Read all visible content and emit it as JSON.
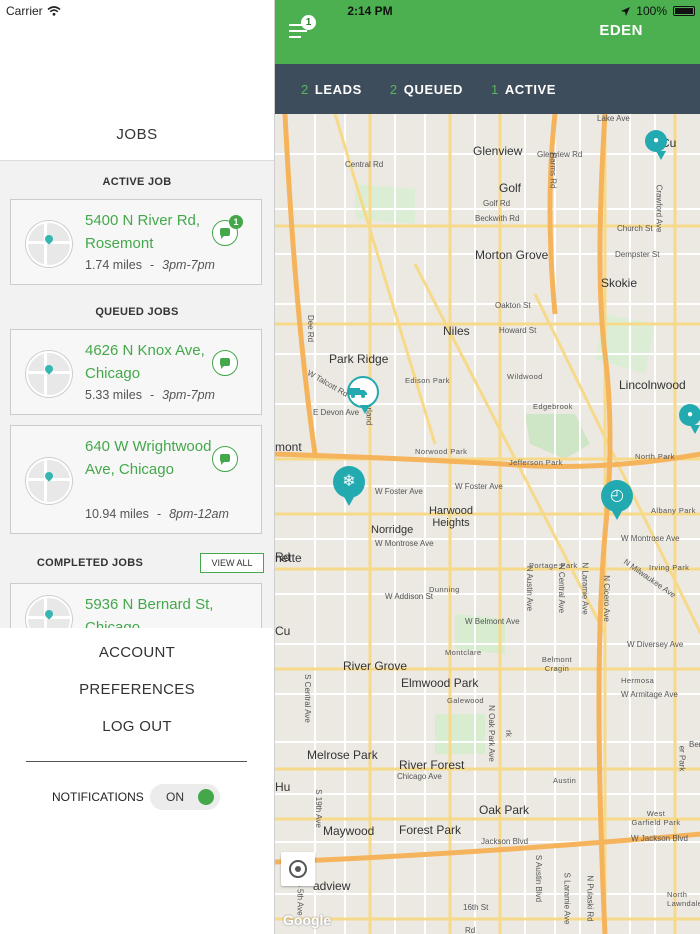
{
  "status_bar": {
    "carrier": "Carrier",
    "time": "2:14 PM",
    "battery": "100%"
  },
  "drawer": {
    "title": "JOBS",
    "active_heading": "ACTIVE JOB",
    "queued_heading": "QUEUED JOBS",
    "completed_heading": "COMPLETED JOBS",
    "view_all": "VIEW ALL",
    "active_job": {
      "address": "5400 N River Rd, Rosemont",
      "distance": "1.74 miles",
      "separator": "-",
      "time": "3pm-7pm",
      "badge": "1"
    },
    "queued_jobs": [
      {
        "address": "4626 N Knox Ave, Chicago",
        "distance": "5.33 miles",
        "separator": "-",
        "time": "3pm-7pm"
      },
      {
        "address": "640 W Wrightwood Ave, Chicago",
        "distance": "10.94 miles",
        "separator": "-",
        "time": "8pm-12am"
      }
    ],
    "completed_jobs": [
      {
        "address": "5936 N Bernard St, Chicago"
      }
    ],
    "menu": {
      "account": "ACCOUNT",
      "preferences": "PREFERENCES",
      "logout": "LOG OUT"
    },
    "notifications": {
      "label": "NOTIFICATIONS",
      "state": "ON"
    }
  },
  "app": {
    "header_title": "EDEN",
    "menu_badge": "1",
    "tabs": [
      {
        "count": "2",
        "label": "LEADS"
      },
      {
        "count": "2",
        "label": "QUEUED"
      },
      {
        "count": "1",
        "label": "ACTIVE"
      }
    ]
  },
  "map": {
    "google": "Google",
    "places": [
      "Lake Ave",
      "Glenview",
      "Glenview Rd",
      "Central Rd",
      "Golf",
      "Golf Rd",
      "Harms Rd",
      "Beckwith Rd",
      "Crawford Ave",
      "Church St",
      "Dempster St",
      "Morton Grove",
      "Skokie",
      "Oakton St",
      "Howard St",
      "Niles",
      "Dee Rd",
      "Park Ridge",
      "W Talcott Rd",
      "E Devon Ave",
      "Cumberland",
      "Edison Park",
      "Wildwood",
      "Edgebrook",
      "Lincolnwood",
      "mont",
      "Norwood Park",
      "Jefferson Park",
      "North Park",
      "Albany Park",
      "W Foster Ave",
      "Harwood Heights",
      "Norridge",
      "W Montrose Ave",
      "Irving Park",
      "Portage Park",
      "N Milwaukee Ave",
      "Dunning",
      "W Addison St",
      "N Austin Ave",
      "N Central Ave",
      "N Laramie Ave",
      "N Cicero Ave",
      "W Belmont Ave",
      "Montclare",
      "Belmont Cragin",
      "River Grove",
      "Hermosa",
      "W Diversey Ave",
      "Elmwood Park",
      "Galewood",
      "W Armitage Ave",
      "Melrose Park",
      "River Forest",
      "N Oak Park Ave",
      "N Harlem Ave",
      "Chicago Ave",
      "Austin",
      "West Garfield Park",
      "Oak Park",
      "Maywood",
      "Forest Park",
      "Jackson Blvd",
      "W Jackson Blvd",
      "adview",
      "16th St",
      "North Lawndale",
      "S 19th Ave",
      "S 25th Ave",
      "25th Ave",
      "S 5th Ave",
      "S Austin Blvd",
      "S Central Ave",
      "S Laramie Ave",
      "N Pulaski Rd",
      "rk",
      "er Park",
      "Hu",
      "nette",
      "Berwyn",
      "Cu",
      "Rd",
      "ARE",
      "1st Ave"
    ]
  }
}
